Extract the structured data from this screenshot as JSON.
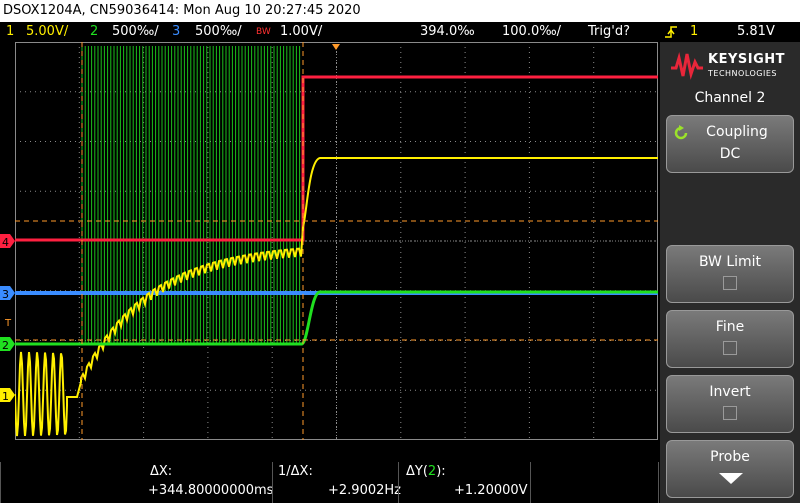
{
  "title": "DSOX1204A, CN59036414: Mon Aug 10 20:27:45 2020",
  "status": {
    "ch1_num": "1",
    "ch1_scale": "5.00V/",
    "ch2_num": "2",
    "ch2_scale": "500‰/",
    "ch3_num": "3",
    "ch3_scale": "500‰/",
    "bw_tag": "BW",
    "ch4_scale": "1.00V/",
    "delay": "394.0‰",
    "timebase": "100.0‰/",
    "trigger_state": "Trig'd?",
    "trigger_source": "1",
    "trigger_level": "5.81V"
  },
  "markers": {
    "ch4": "4",
    "ch3": "3",
    "ch2": "2",
    "ch1": "1",
    "trigger": "T"
  },
  "panel": {
    "brand_name": "KEYSIGHT",
    "brand_sub": "TECHNOLOGIES",
    "title": "Channel 2",
    "coupling_label": "Coupling",
    "coupling_value": "DC",
    "bw_limit_label": "BW Limit",
    "fine_label": "Fine",
    "invert_label": "Invert",
    "probe_label": "Probe"
  },
  "cursors": {
    "dx_label": "ΔX:",
    "dx_value": "+344.80000000ms",
    "inv_dx_label": "1/ΔX:",
    "inv_dx_value": "+2.9002Hz",
    "dy_label": "ΔY(2):",
    "dy_value": "+1.20000V"
  },
  "colors": {
    "ch1": "#ffef00",
    "ch2": "#20e020",
    "ch3": "#3a8cff",
    "ch4": "#ff2040",
    "cursor": "#ff9a2a",
    "grid": "#8a8a8a"
  }
}
